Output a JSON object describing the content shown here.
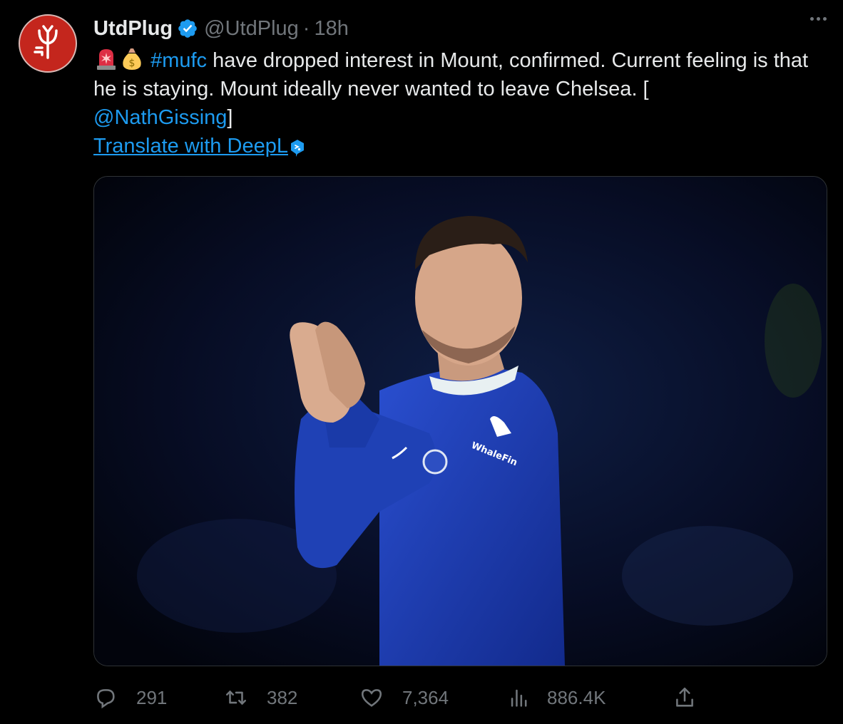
{
  "author": {
    "name": "UtdPlug",
    "handle": "@UtdPlug",
    "separator": "·",
    "time": "18h",
    "avatar_icon": "trident-icon",
    "verified_icon": "verified-badge-icon",
    "brand_color": "#c4261d"
  },
  "tweet": {
    "emojis": [
      "rotating-light-icon",
      "money-bag-icon"
    ],
    "hashtag": "#mufc",
    "text_part1": " have dropped interest in Mount, confirmed. Current feeling is that he is staying. Mount ideally never wanted to leave Chelsea. [",
    "mention": "@NathGissing",
    "text_part2": "]",
    "translate_label": "Translate with DeepL",
    "translate_icon": "deepl-icon"
  },
  "media": {
    "type": "photo",
    "sponsor_text": "WhaleFin"
  },
  "actions": {
    "replies": "291",
    "retweets": "382",
    "likes": "7,364",
    "views": "886.4K"
  },
  "colors": {
    "link": "#1d9bf0",
    "muted": "#71767b",
    "text": "#e7e9ea",
    "background": "#000000"
  }
}
